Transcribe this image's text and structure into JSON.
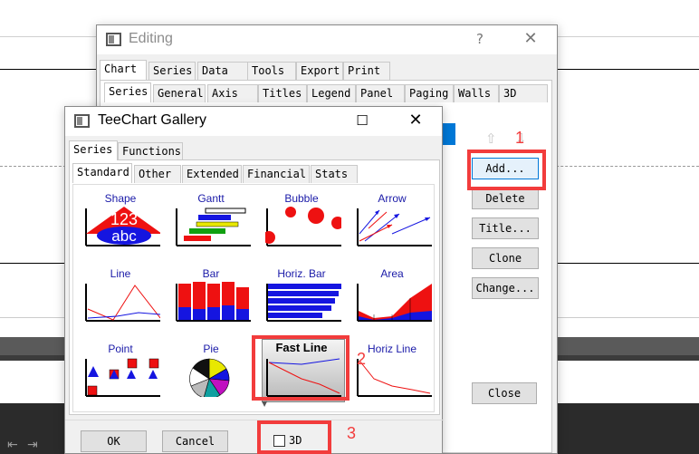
{
  "editing": {
    "title": "Editing",
    "help": "?",
    "close": "✕",
    "tabs_top": [
      "Chart",
      "Series",
      "Data",
      "Tools",
      "Export",
      "Print"
    ],
    "tabs_second": [
      "Series",
      "General",
      "Axis",
      "Titles",
      "Legend",
      "Panel",
      "Paging",
      "Walls",
      "3D"
    ],
    "buttons": {
      "add": "Add...",
      "delete": "Delete",
      "title": "Title...",
      "clone": "Clone",
      "change": "Change...",
      "close": "Close"
    }
  },
  "gallery": {
    "title": "TeeChart Gallery",
    "maximize": "☐",
    "close": "✕",
    "tabs_top": [
      "Series",
      "Functions"
    ],
    "tabs_second": [
      "Standard",
      "Other",
      "Extended",
      "Financial",
      "Stats"
    ],
    "items": [
      {
        "name": "Shape",
        "icon": "shape-icon"
      },
      {
        "name": "Gantt",
        "icon": "gantt-icon"
      },
      {
        "name": "Bubble",
        "icon": "bubble-icon"
      },
      {
        "name": "Arrow",
        "icon": "arrow-icon"
      },
      {
        "name": "Line",
        "icon": "line-icon"
      },
      {
        "name": "Bar",
        "icon": "bar-icon"
      },
      {
        "name": "Horiz. Bar",
        "icon": "horiz-bar-icon"
      },
      {
        "name": "Area",
        "icon": "area-icon"
      },
      {
        "name": "Point",
        "icon": "point-icon"
      },
      {
        "name": "Pie",
        "icon": "pie-icon"
      },
      {
        "name": "Fast Line",
        "icon": "fast-line-icon",
        "selected": true
      },
      {
        "name": "Horiz Line",
        "icon": "horiz-line-icon"
      }
    ],
    "shape_text_top": "123",
    "shape_text_bottom": "abc",
    "ok": "OK",
    "cancel": "Cancel",
    "checkbox_3d": "3D",
    "checkbox_3d_checked": false
  },
  "annotations": {
    "label1": "1",
    "label2": "2",
    "label3": "3",
    "color": "#f23c3c"
  }
}
